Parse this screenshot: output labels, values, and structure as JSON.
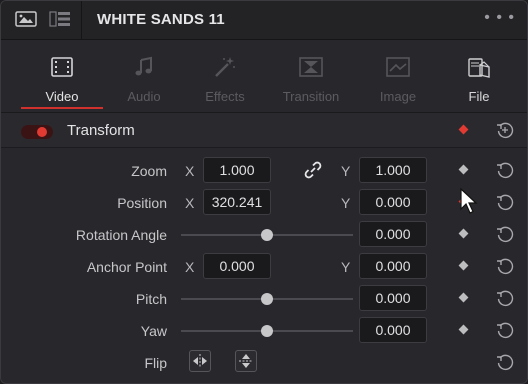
{
  "title": "WHITE SANDS 11",
  "menu_icon": "ellipsis-icon",
  "tabs": [
    {
      "label": "Video",
      "icon": "film-icon",
      "active": true
    },
    {
      "label": "Audio",
      "icon": "music-note-icon",
      "active": false
    },
    {
      "label": "Effects",
      "icon": "magic-wand-icon",
      "active": false
    },
    {
      "label": "Transition",
      "icon": "transition-icon",
      "active": false
    },
    {
      "label": "Image",
      "icon": "image-icon",
      "active": false
    },
    {
      "label": "File",
      "icon": "file-icon",
      "active": false
    }
  ],
  "section": {
    "title": "Transform",
    "enabled": true
  },
  "rows": {
    "zoom": {
      "label": "Zoom",
      "x_axis": "X",
      "x_value": "1.000",
      "y_axis": "Y",
      "y_value": "1.000"
    },
    "position": {
      "label": "Position",
      "x_axis": "X",
      "x_value": "320.241",
      "y_axis": "Y",
      "y_value": "0.000"
    },
    "rotation": {
      "label": "Rotation Angle",
      "value": "0.000"
    },
    "anchor": {
      "label": "Anchor Point",
      "x_axis": "X",
      "x_value": "0.000",
      "y_axis": "Y",
      "y_value": "0.000"
    },
    "pitch": {
      "label": "Pitch",
      "value": "0.000"
    },
    "yaw": {
      "label": "Yaw",
      "value": "0.000"
    },
    "flip": {
      "label": "Flip"
    }
  },
  "colors": {
    "accent": "#d0312d",
    "keyframe_active": "#e03a33",
    "keyframe_inactive": "#bdbdc0"
  }
}
